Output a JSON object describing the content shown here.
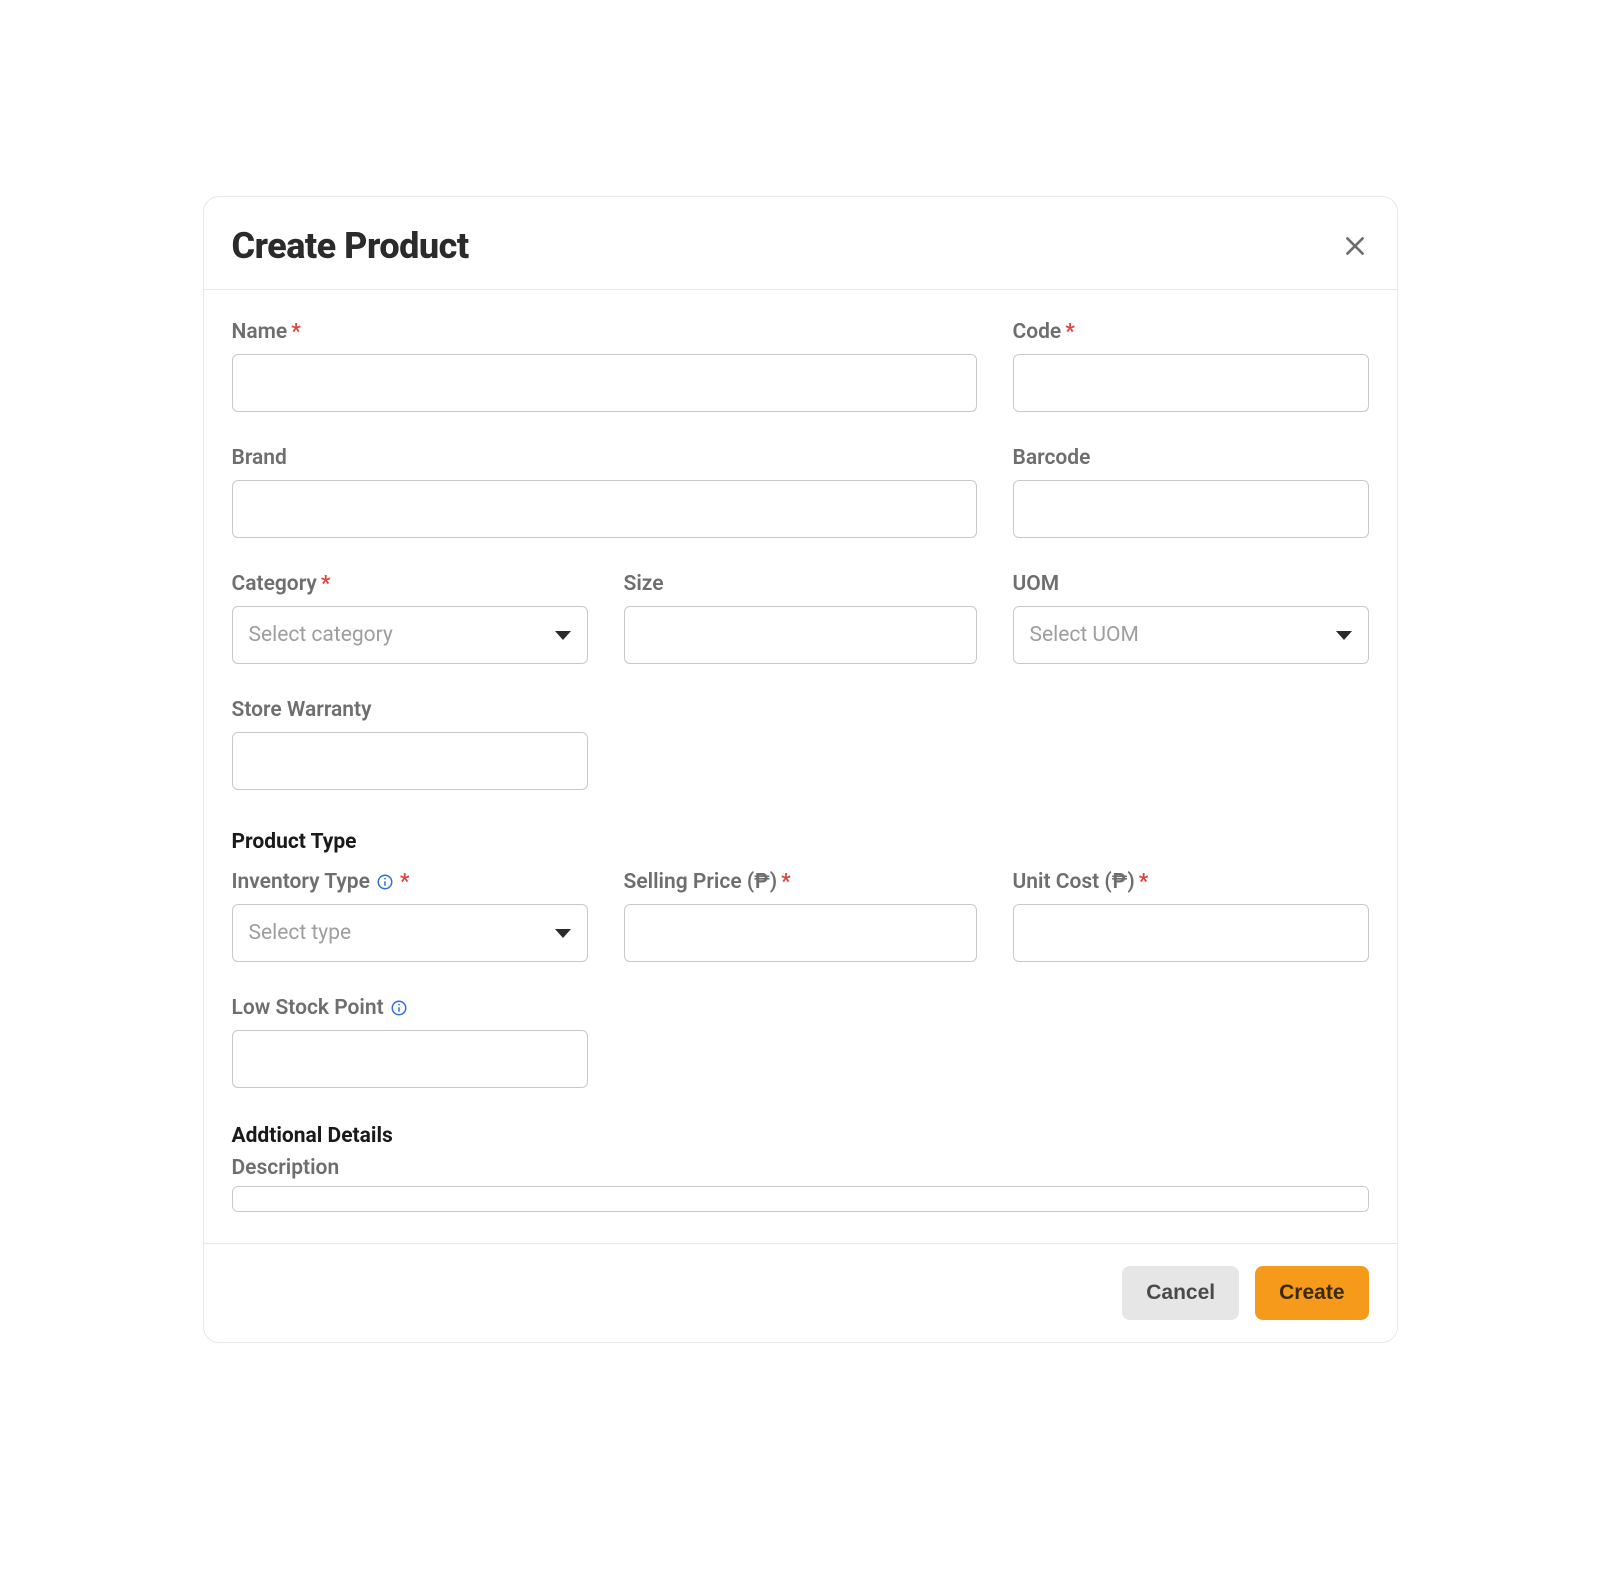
{
  "modal": {
    "title": "Create Product",
    "fields": {
      "name_label": "Name",
      "code_label": "Code",
      "brand_label": "Brand",
      "barcode_label": "Barcode",
      "category_label": "Category",
      "category_placeholder": "Select category",
      "size_label": "Size",
      "uom_label": "UOM",
      "uom_placeholder": "Select UOM",
      "store_warranty_label": "Store Warranty"
    },
    "product_type": {
      "heading": "Product Type",
      "inventory_type_label": "Inventory Type",
      "inventory_type_placeholder": "Select type",
      "selling_price_label": "Selling Price (₱)",
      "unit_cost_label": "Unit Cost (₱)",
      "low_stock_label": "Low Stock Point"
    },
    "additional": {
      "heading": "Addtional Details",
      "description_label": "Description"
    },
    "footer": {
      "cancel": "Cancel",
      "create": "Create"
    }
  }
}
